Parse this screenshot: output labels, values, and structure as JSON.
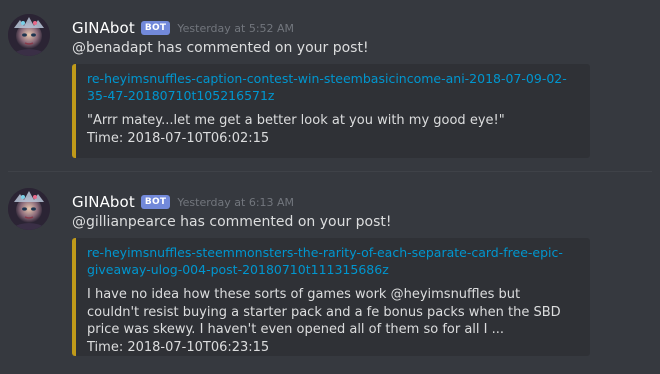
{
  "colors": {
    "background": "#36393f",
    "embed_background": "#2f3136",
    "embed_accent": "#c09a1a",
    "link": "#0096cf",
    "bot_tag": "#7289da",
    "username": "#ffffff",
    "timestamp": "#72767d"
  },
  "messages": [
    {
      "username": "GINAbot",
      "bot_tag": "BOT",
      "timestamp": "Yesterday at 5:52 AM",
      "content": "@benadapt has commented on your post!",
      "embed": {
        "title": "re-heyimsnuffles-caption-contest-win-steembasicincome-ani-2018-07-09-02-35-47-20180710t105216571z",
        "description": "\"Arrr matey...let me get a better look at you with my good eye!\"",
        "time": "Time: 2018-07-10T06:02:15"
      }
    },
    {
      "username": "GINAbot",
      "bot_tag": "BOT",
      "timestamp": "Yesterday at 6:13 AM",
      "content": "@gillianpearce has commented on your post!",
      "embed": {
        "title": "re-heyimsnuffles-steemmonsters-the-rarity-of-each-separate-card-free-epic-giveaway-ulog-004-post-20180710t111315686z",
        "description": "I have no idea how these sorts of games work @heyimsnuffles but couldn't resist buying a starter pack and a fe bonus packs when the SBD price was skewy. I haven't even opened all of them so for all I ...",
        "time": "Time: 2018-07-10T06:23:15"
      }
    }
  ]
}
